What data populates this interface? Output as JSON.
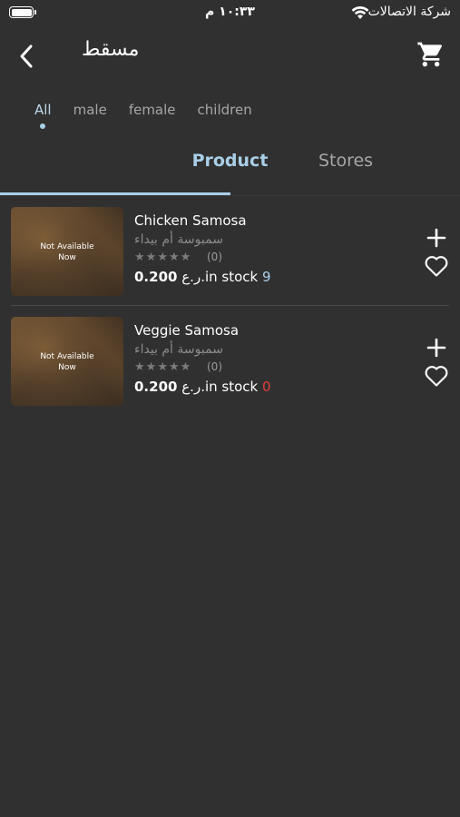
{
  "status_bar": {
    "time": "١٠:٣٣ م",
    "carrier": "شركة الاتصالات"
  },
  "header": {
    "title": "مسقط"
  },
  "filters": [
    {
      "label": "All",
      "active": true
    },
    {
      "label": "male",
      "active": false
    },
    {
      "label": "female",
      "active": false
    },
    {
      "label": "children",
      "active": false
    }
  ],
  "tabs": {
    "product": "Product",
    "stores": "Stores",
    "active": "product"
  },
  "products": [
    {
      "name": "Chicken Samosa",
      "arabic_name": "سمبوسة أم بيداء",
      "image_text_line1": "Not Available",
      "image_text_line2": "Now",
      "rating": 5,
      "rating_count": "(0)",
      "price": "0.200",
      "currency": "ر.ع.",
      "stock_label": "in stock",
      "stock_count": "9",
      "stock_color": "#a9cfe8"
    },
    {
      "name": "Veggie Samosa",
      "arabic_name": "سمبوسة أم بيداء",
      "image_text_line1": "Not Available",
      "image_text_line2": "Now",
      "rating": 5,
      "rating_count": "(0)",
      "price": "0.200",
      "currency": "ر.ع.",
      "stock_label": "in stock",
      "stock_count": "0",
      "stock_color": "#e33b3b"
    }
  ],
  "colors": {
    "background": "#303030",
    "accent": "#a9cfe8",
    "out_of_stock": "#e33b3b"
  },
  "icons": [
    "battery-icon",
    "wifi-icon",
    "back-chevron-icon",
    "cart-icon",
    "plus-icon",
    "heart-outline-icon",
    "star-icon"
  ]
}
